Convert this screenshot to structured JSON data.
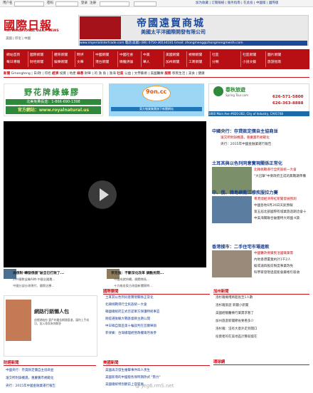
{
  "topbar": {
    "user_label": "用户名",
    "password_label": "密码",
    "login_label": "登录",
    "register_label": "注册",
    "right_links": "加为收藏 | 订閱報紙 | 服务指南 | 在此投 | 中國版 | 國際版"
  },
  "logo": {
    "title": "國際日報",
    "subtitle": "INTERNATIONAL DAILY NEWS",
    "regions": "美國 | 印尼 | 中國"
  },
  "banner_top": {
    "title": "帝國遠貿商城",
    "subtitle": "美國太平洋國際開發有限公司",
    "info": "www.imperialintertrade.com    電話(美國) (86) 0750-36534181  Email: zhongmeng@zhongmengmeishi.com"
  },
  "nav": {
    "columns": [
      {
        "items": [
          "網站首頁",
          "每日導報"
        ]
      },
      {
        "items": [
          "國際新聞",
          "财经新聞"
        ]
      },
      {
        "items": [
          "體育新聞",
          "娛樂新聞"
        ]
      },
      {
        "items": [
          "時評",
          "文華"
        ]
      },
      {
        "items": [
          "中國新聞",
          "港台新聞"
        ]
      },
      {
        "items": [
          "中國社會",
          "微雜評論"
        ]
      },
      {
        "items": [
          "中美",
          "華人"
        ]
      },
      {
        "items": [
          "美國新聞",
          "加州新聞"
        ]
      },
      {
        "items": [
          "視頻新聞",
          "工商新聞"
        ]
      },
      {
        "items": [
          "社區",
          "分類"
        ]
      },
      {
        "items": [
          "社區新聞",
          "小說文藝"
        ]
      },
      {
        "items": [
          "圖片新聞",
          "旅游指南"
        ]
      }
    ]
  },
  "subnav": {
    "news_label": "新聞",
    "news_links": "Gmengteng | 日/政 | 印尼",
    "economy_label": "經濟",
    "economy_links": "投資 | 地產",
    "sports_label": "綠蓉",
    "sports_links": "財華 | 的 漁 魚 | 漁海",
    "society_label": "社區",
    "society_links": "公益 | 文學藝術 | 美國醫療",
    "services_label": "服務",
    "services_links": "移民生活 | 美食 | 健康"
  },
  "ads": {
    "ad1_title": "野花牌綠蜂膠",
    "ad1_phone": "北美免費長途：1-866-690-1398",
    "ad1_site": "官方網站：www.royalnatural.us",
    "ad2_brand": "9on.cc",
    "ad2_tagline": "東方報業集團旗下新聞網站",
    "ad3_brand": "春秋旅遊",
    "ad3_brand_en": "Spring Tour.com",
    "ad3_phone1": "626-571-5800",
    "ad3_phone2": "626-363-8888",
    "ad3_address": "1860 Main Ave #820-282, City of Industry, CA91748"
  },
  "right_news": [
    {
      "headline": "中國央行：存貸款定價自主協商並",
      "lines": [
        "滬交所附錄機遇，重慶籌市規範化",
        "央行：2015年中國金融業運行報告"
      ]
    },
    {
      "headline": "土耳其與以色列同意實現關係正常化",
      "lines": [
        "北韓挑戰導行全民族統一大會",
        "\"大已擊\"中東政府王成的無戰期準備"
      ]
    },
    {
      "headline": "中、俄、韓島嶼衝江穆疾服拉力賽",
      "lines": [
        "粵港澳經濟帶紅新聞發展預測",
        "中國各地6月26日天氣預報",
        "第五屆北部國際有城業旅遊期洽會十",
        "中美海關聯合破獲特大跨國·K貨"
      ]
    },
    {
      "headline": "香港搜市：二手住宅市場進軟",
      "lines": [
        "中國醫改要廣民洽國職業需",
        "內地香港置業約計1千2人",
        "擬或滬四股前製度事業改免",
        "科學家發現過度能會嚴格引吸收"
      ]
    }
  ],
  "video_captions": {
    "left_title": "烏俄對·轉發俄援\"破旦已打敗了...",
    "left_sub1": "2I中國教益機AI時·中國全國農...",
    "left_sub2": "中國分部分改現代、國際治療...",
    "right_title": "李克強：不斷深化改革 調動民間...",
    "right_sub1": "中國成就持續，開關增長...",
    "right_sub2": "十方維各東方改變新聞實時..."
  },
  "bottom": {
    "intl_section": "國際要聞",
    "intl_items": [
      "土耳其以色列同意實現關係正常化",
      "北韓挑戰導行全民族統一大會",
      "韓國總統府正式否認軍方保護特統事宜",
      "剛提選後繼大戰基督教主題公開",
      "中日韓自貿區第十輪談判在首爾舉辦",
      "菲律賓：台灣總理經營政權兩月後參"
    ],
    "us_section": "美國新聞",
    "us_items": [
      "美國再次發生槍擊事件四人喪生",
      "美國新增的中國版各保時期改式 \"勢力\"",
      "美國總統特別觀前上官官員"
    ],
    "ca_section": "加州新聞",
    "ca_items": [
      "洛杉磯擁堵將超長至1人數",
      "洛杉磯旅遊 新疆小新聞",
      "美國經驗醫療行業需求看了",
      "加州旅遊新聞節省要看多少",
      "洛杉磯：沒有大意外走到開口",
      "投資者的在美地區計算就能在"
    ],
    "env_section": "環球網",
    "fin_section": "財經新聞",
    "fin_items": [
      "中國央行：存貸款定價自主協商並",
      "滬交所附錄機遇，重慶籌市規範化",
      "央行：2015年中國金融業運行報告"
    ],
    "ad_title": "網路行銷懶人包",
    "ad_sub": "這裡就給你 客戶的最佳網路管道，讓你上手成功，加入專家為你解答"
  },
  "watermark": "@ Jeg6.rmS.net",
  "colors": {
    "brand_red": "#c8141a",
    "nav_red": "#b70f14",
    "link_blue": "#1b3f8f",
    "green": "#2e8a3a"
  }
}
